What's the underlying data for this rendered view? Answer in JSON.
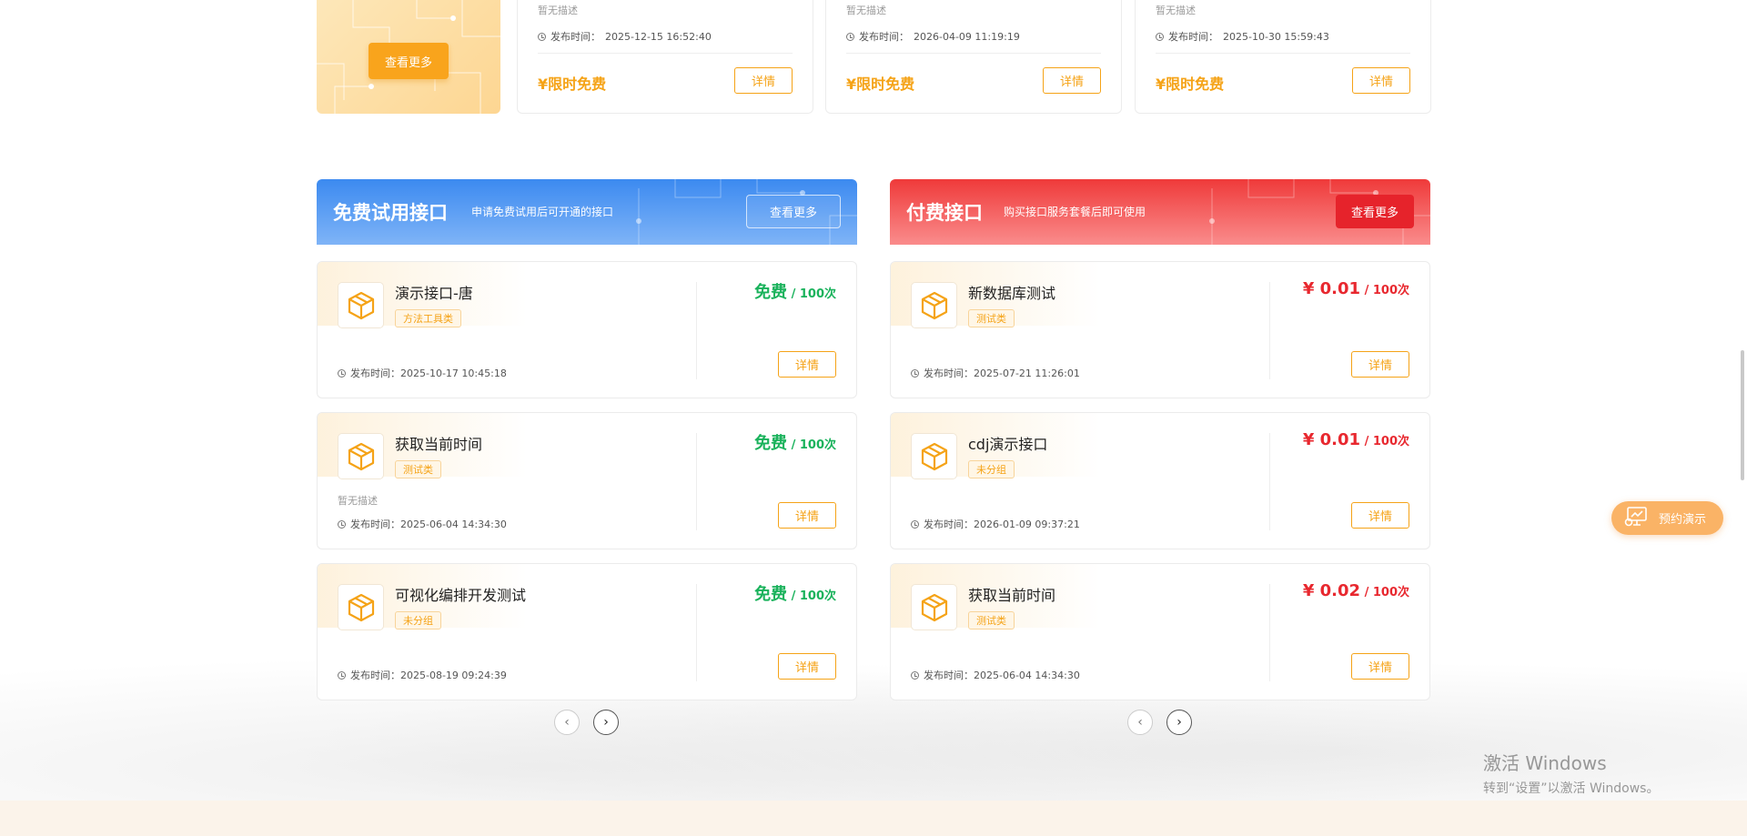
{
  "top_row": {
    "promo_button": "查看更多",
    "cards": [
      {
        "desc": "暂无描述",
        "time_label": "发布时间：",
        "time": "2025-12-15 16:52:40",
        "price": "¥限时免费",
        "detail": "详情"
      },
      {
        "desc": "暂无描述",
        "time_label": "发布时间：",
        "time": "2026-04-09 11:19:19",
        "price": "¥限时免费",
        "detail": "详情"
      },
      {
        "desc": "暂无描述",
        "time_label": "发布时间：",
        "time": "2025-10-30 15:59:43",
        "price": "¥限时免费",
        "detail": "详情"
      }
    ]
  },
  "free_section": {
    "title": "免费试用接口",
    "subtitle": "申请免费试用后可开通的接口",
    "more": "查看更多",
    "accent": "#3c8af0",
    "cards": [
      {
        "name": "演示接口-唐",
        "tag": "方法工具类",
        "desc": "",
        "time_label": "发布时间：",
        "time": "2025-10-17 10:45:18",
        "price": "免费",
        "unit": " / 100次",
        "detail": "详情"
      },
      {
        "name": "获取当前时间",
        "tag": "测试类",
        "desc": "暂无描述",
        "time_label": "发布时间：",
        "time": "2025-06-04 14:34:30",
        "price": "免费",
        "unit": " / 100次",
        "detail": "详情"
      },
      {
        "name": "可视化编排开发测试",
        "tag": "未分组",
        "desc": "",
        "time_label": "发布时间：",
        "time": "2025-08-19 09:24:39",
        "price": "免费",
        "unit": " / 100次",
        "detail": "详情"
      }
    ]
  },
  "paid_section": {
    "title": "付费接口",
    "subtitle": "购买接口服务套餐后即可使用",
    "more": "查看更多",
    "accent": "#ef3a3a",
    "cards": [
      {
        "name": "新数据库测试",
        "tag": "测试类",
        "desc": "",
        "time_label": "发布时间：",
        "time": "2025-07-21 11:26:01",
        "price": "¥ 0.01",
        "unit": " / 100次",
        "detail": "详情"
      },
      {
        "name": "cdj演示接口",
        "tag": "未分组",
        "desc": "",
        "time_label": "发布时间：",
        "time": "2026-01-09 09:37:21",
        "price": "¥ 0.01",
        "unit": " / 100次",
        "detail": "详情"
      },
      {
        "name": "获取当前时间",
        "tag": "测试类",
        "desc": "",
        "time_label": "发布时间：",
        "time": "2025-06-04 14:34:30",
        "price": "¥ 0.02",
        "unit": " / 100次",
        "detail": "详情"
      }
    ]
  },
  "pager": {
    "prev": "‹",
    "next": "›"
  },
  "float_button": {
    "label": "预约演示",
    "icon": "chart-monitor-icon"
  },
  "watermark": {
    "line1": "激活 Windows",
    "line2": "转到“设置”以激活 Windows。"
  },
  "colors": {
    "orange": "#f5a317",
    "green": "#19b25b",
    "red": "#e8282f"
  }
}
